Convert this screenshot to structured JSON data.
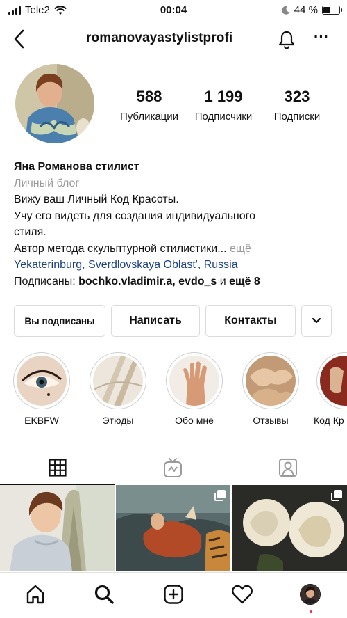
{
  "status": {
    "carrier": "Tele2",
    "time": "00:04",
    "battery": "44 %",
    "battery_level": 0.44
  },
  "header": {
    "username": "romanovayastylistprofi"
  },
  "profile": {
    "stats": [
      {
        "value": "588",
        "label": "Публикации"
      },
      {
        "value": "1 199",
        "label": "Подписчики"
      },
      {
        "value": "323",
        "label": "Подписки"
      }
    ],
    "name": "Яна Романова стилист",
    "category": "Личный блог",
    "bio_lines": [
      "Вижу ваш Личный Код Красоты.",
      "Учу его видеть для создания индивидуального",
      "стиля.",
      "Автор метода скульптурной стилистики..."
    ],
    "bio_more": " ещё",
    "location": "Yekaterinburg, Sverdlovskaya Oblast', Russia",
    "followed_by_prefix": "Подписаны: ",
    "followed_by_names": "bochko.vladimir.a, evdo_s",
    "followed_by_suffix": " и ",
    "followed_by_more": "ещё 8"
  },
  "buttons": {
    "subscribed": "Вы подписаны",
    "message": "Написать",
    "contacts": "Контакты"
  },
  "highlights": [
    {
      "label": "EKBFW"
    },
    {
      "label": "Этюды"
    },
    {
      "label": "Обо мне"
    },
    {
      "label": "Отзывы"
    },
    {
      "label": "Код Кр"
    }
  ],
  "colors": {
    "link": "#1b3f87",
    "muted": "#9a9a9a",
    "border": "#dbdbdb",
    "notification_dot": "#e8354a"
  }
}
